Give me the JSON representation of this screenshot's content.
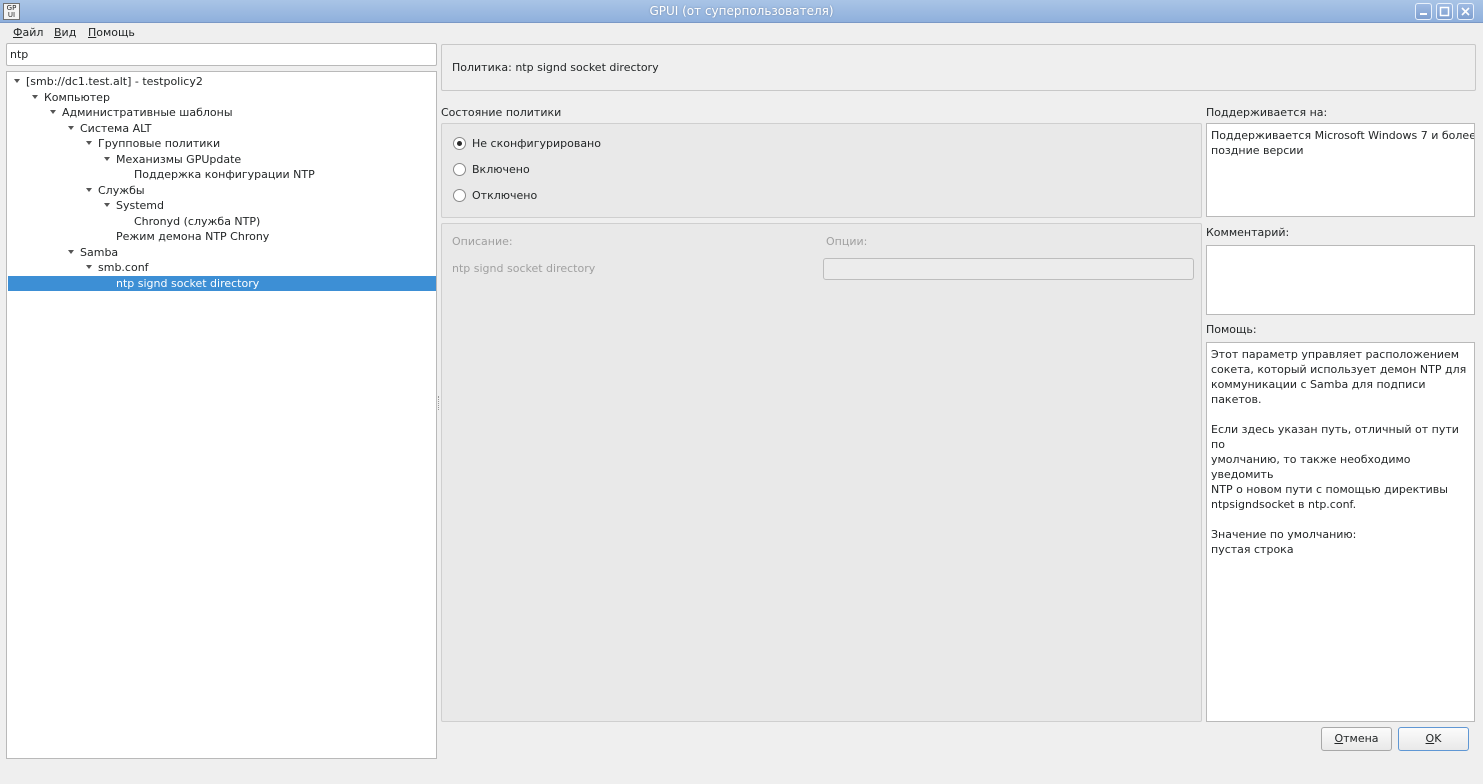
{
  "window": {
    "icon_text": "GP\nUI",
    "title": "GPUI (от суперпользователя)"
  },
  "menu": [
    "Файл",
    "Вид",
    "Помощь"
  ],
  "search": {
    "value": "ntp"
  },
  "tree": [
    {
      "label": "[smb://dc1.test.alt] - testpolicy2",
      "level": 0,
      "expanded": true
    },
    {
      "label": "Компьютер",
      "level": 1,
      "expanded": true
    },
    {
      "label": "Административные шаблоны",
      "level": 2,
      "expanded": true
    },
    {
      "label": "Система ALT",
      "level": 3,
      "expanded": true
    },
    {
      "label": "Групповые политики",
      "level": 4,
      "expanded": true
    },
    {
      "label": "Механизмы GPUpdate",
      "level": 5,
      "expanded": true
    },
    {
      "label": "Поддержка конфигурации NTP",
      "level": 6,
      "expanded": false
    },
    {
      "label": "Службы",
      "level": 4,
      "expanded": true
    },
    {
      "label": "Systemd",
      "level": 5,
      "expanded": true
    },
    {
      "label": "Chronyd (служба NTP)",
      "level": 6,
      "expanded": false
    },
    {
      "label": "Режим демона NTP Chrony",
      "level": 5,
      "expanded": false
    },
    {
      "label": "Samba",
      "level": 3,
      "expanded": true
    },
    {
      "label": "smb.conf",
      "level": 4,
      "expanded": true
    },
    {
      "label": "ntp signd socket directory",
      "level": 5,
      "expanded": false,
      "selected": true
    }
  ],
  "policy": {
    "title": "Политика: ntp signd socket directory"
  },
  "state": {
    "label": "Состояние политики",
    "options": [
      {
        "label": "Не сконфигурировано",
        "checked": true
      },
      {
        "label": "Включено",
        "checked": false
      },
      {
        "label": "Отключено",
        "checked": false
      }
    ]
  },
  "options_panel": {
    "description_header": "Описание:",
    "options_header": "Опции:",
    "option_name": "ntp signd socket directory",
    "option_value": ""
  },
  "supported": {
    "label": "Поддерживается на:",
    "text": "Поддерживается Microsoft Windows 7 и более\nпоздние версии"
  },
  "comment": {
    "label": "Комментарий:",
    "value": ""
  },
  "help": {
    "label": "Помощь:",
    "text": "Этот параметр управляет расположением\nсокета, который использует демон NTP для\nкоммуникации с Samba для подписи пакетов.\n\nЕсли здесь указан путь, отличный от пути по\nумолчанию, то также необходимо уведомить\nNTP о новом пути с помощью директивы\nntpsigndsocket в ntp.conf.\n\nЗначение по умолчанию:\nпустая строка"
  },
  "buttons": {
    "cancel": "Отмена",
    "ok": "OK"
  },
  "colors": {
    "selection": "#3d8fd5",
    "titlebar": "#9ab8e1"
  }
}
